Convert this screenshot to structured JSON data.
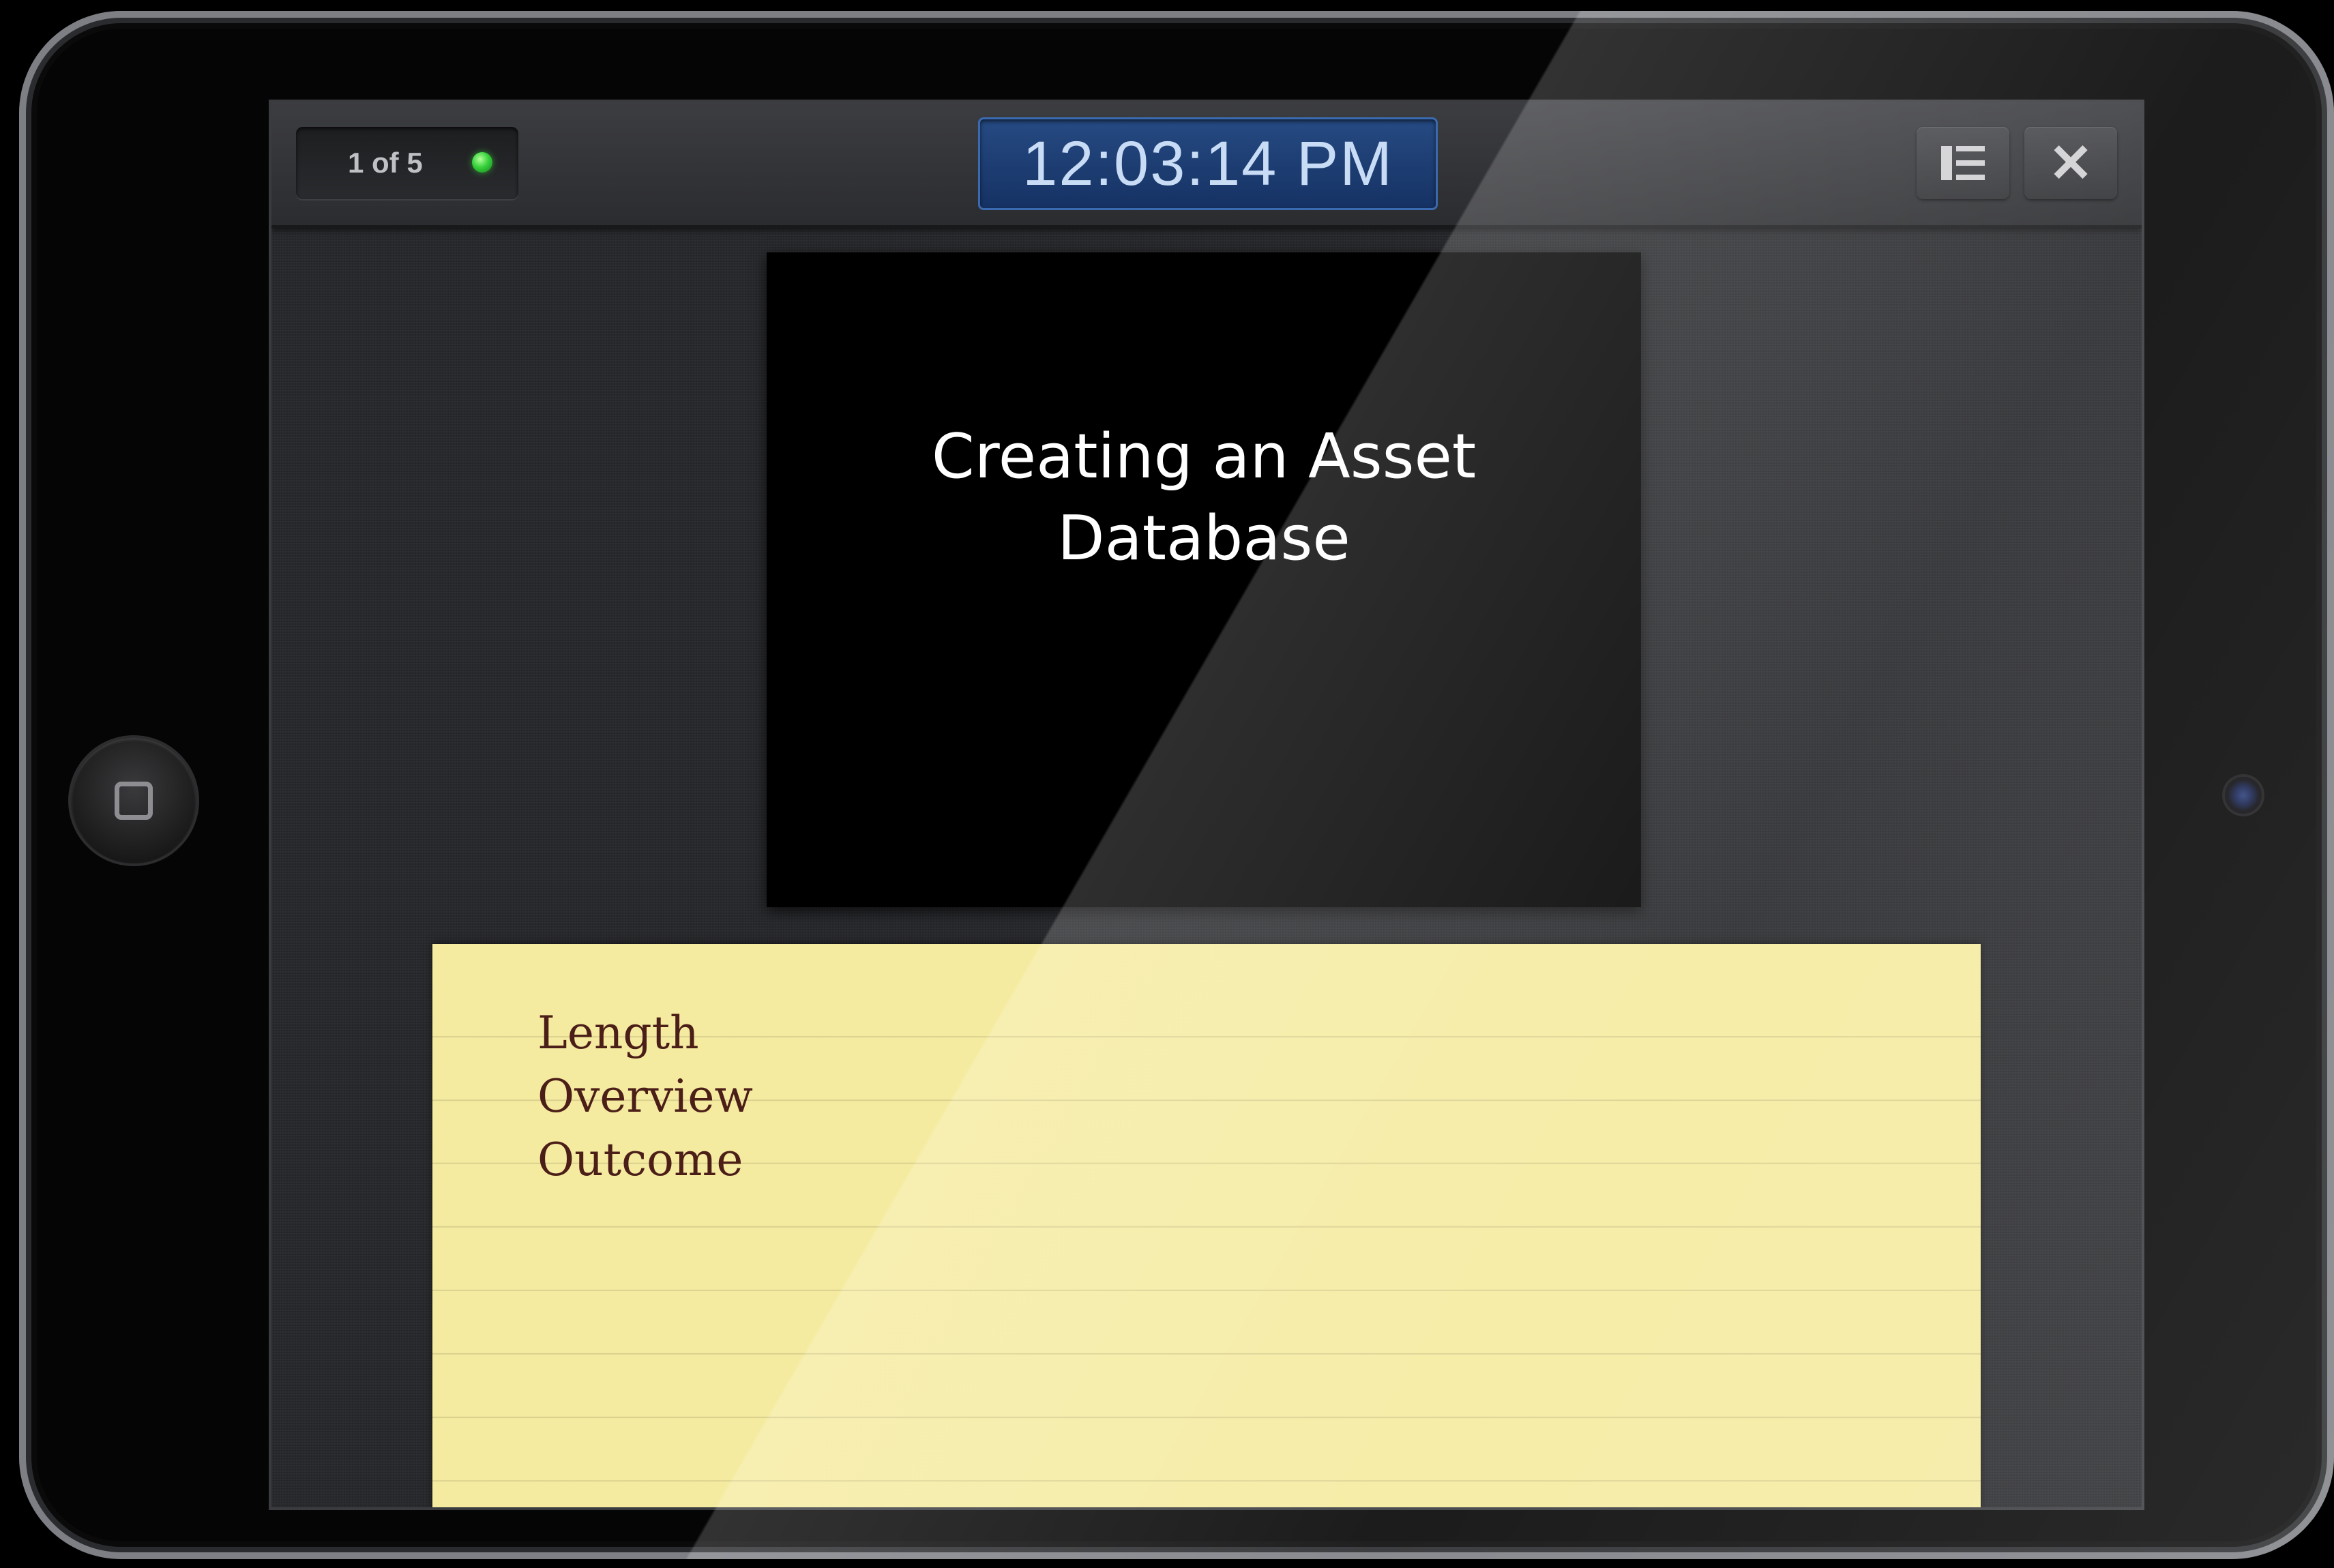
{
  "toolbar": {
    "slide_counter": "1 of 5",
    "clock": "12:03:14 PM",
    "layout_icon": "layout-icon",
    "close_icon": "close-icon",
    "close_glyph": "✕"
  },
  "slide": {
    "title_line1": "Creating an Asset",
    "title_line2": "Database"
  },
  "notes": {
    "lines": [
      "Length",
      "Overview",
      "Outcome"
    ]
  },
  "colors": {
    "status_dot": "#37d23c",
    "clock_bg": "#1d3f74",
    "notes_bg": "#f5eba0",
    "notes_text": "#4b1f18"
  }
}
